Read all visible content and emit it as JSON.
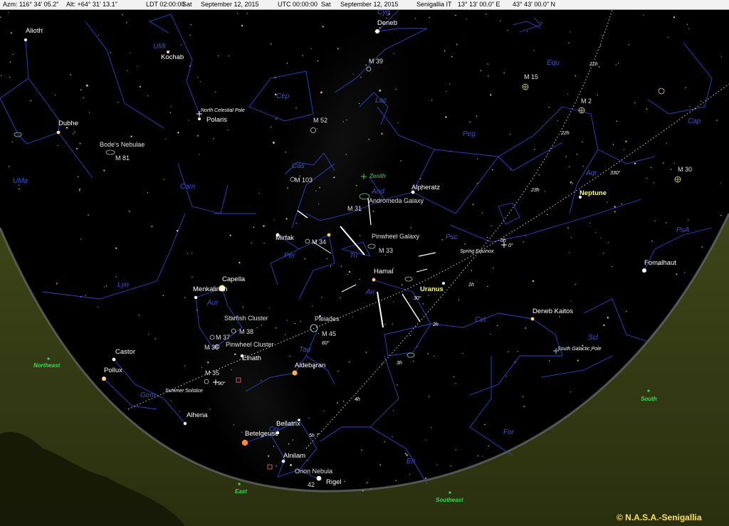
{
  "status": {
    "azimuth": "Azm: 116° 34' 05.2\"",
    "altitude": "Alt: +64° 31' 13.1\"",
    "local_time": "LDT 02:00:00",
    "local_day": "Sat",
    "local_date": "September 12, 2015",
    "utc_time": "UTC 00:00:00",
    "utc_day": "Sat",
    "utc_date": "September 12, 2015",
    "location": "Senigallia IT",
    "longitude": "13° 13' 00.0\" E",
    "latitude": "43° 43' 00.0\" N"
  },
  "stars": {
    "alioth": "Alioth",
    "kochab": "Kochab",
    "dubhe": "Dubhe",
    "polaris": "Polaris",
    "deneb": "Deneb",
    "alpheratz": "Alpheratz",
    "mirfak": "Mirfak",
    "hamal": "Hamal",
    "capella": "Capella",
    "menkalinan": "Menkalinan",
    "castor": "Castor",
    "pollux": "Pollux",
    "elnath": "Elnath",
    "aldebaran": "Aldebaran",
    "alhena": "Alhena",
    "bellatrix": "Bellatrix",
    "betelgeuse": "Betelgeuse",
    "alnilam": "Alnilam",
    "rigel": "Rigel",
    "fomalhaut": "Fomalhaut",
    "deneb_kaitos": "Deneb Kaitos"
  },
  "planets": {
    "uranus": "Uranus",
    "neptune": "Neptune"
  },
  "dso": {
    "m39": "M 39",
    "m15": "M 15",
    "m2": "M 2",
    "m52": "M 52",
    "m81": "M 81",
    "bodes": "Bode's Nebulae",
    "m103": "M 103",
    "m30": "M 30",
    "m31": "M 31",
    "andromeda": "Andromeda Galaxy",
    "m33": "M 33",
    "pinwheel": "Pinwheel Galaxy",
    "m34": "M 34",
    "m45": "M 45",
    "pleiades": "Pleiades",
    "m38": "M 38",
    "starfish": "Starfish Cluster",
    "m37": "M 37",
    "m36": "M 36",
    "pinwheel_cluster": "Pinwheel Cluster",
    "m35": "M 35",
    "orion_nebula": "Orion Nebula",
    "m42": "42"
  },
  "constellations": {
    "cyg": "Cyg",
    "umi": "UMi",
    "equ": "Equ",
    "cep": "Cep",
    "lac": "Lac",
    "peg": "Peg",
    "cap": "Cap",
    "uma": "UMa",
    "cam": "Cam",
    "cas": "Cas",
    "and": "And",
    "aqr": "Aqr",
    "psa": "PsA",
    "psc": "Psc",
    "tri": "Tri",
    "per": "Per",
    "ari": "Ari",
    "lyn": "Lyn",
    "aur": "Aur",
    "cet": "Cet",
    "scl": "Scl",
    "tau": "Tau",
    "gem": "Gem",
    "for": "For",
    "eri": "Eri",
    "ori": "Ori"
  },
  "reference": {
    "ncp": "North Celestial Pole",
    "zenith": "Zenith",
    "spring_equinox": "Spring Equinox",
    "summer_solstice": "Summer Solstice",
    "sgp": "South Galactic Pole",
    "deg0": "0°",
    "deg30": "30°",
    "deg60": "60°",
    "deg90": "90°",
    "deg330": "330°"
  },
  "hours": {
    "h21": "21h",
    "h22": "22h",
    "h23": "23h",
    "h0": "0h",
    "h1": "1h",
    "h2": "2h",
    "h3": "3h",
    "h4": "4h",
    "h5": "5h"
  },
  "directions": {
    "northeast": "Northeast",
    "east": "East",
    "southeast": "Southeast",
    "south": "South"
  },
  "copyright": "© N.A.S.A.-Senigallia",
  "colors": {
    "background": "#000000",
    "ground": "#3d4418",
    "ground_dark": "#262c0c",
    "constellation_line": "#2847c8",
    "constellation_label": "#3a52d6",
    "ecliptic": "#ffffff",
    "direction_label": "#33dd55",
    "planet_label": "#ffff66",
    "copyright": "#ffe04a"
  }
}
